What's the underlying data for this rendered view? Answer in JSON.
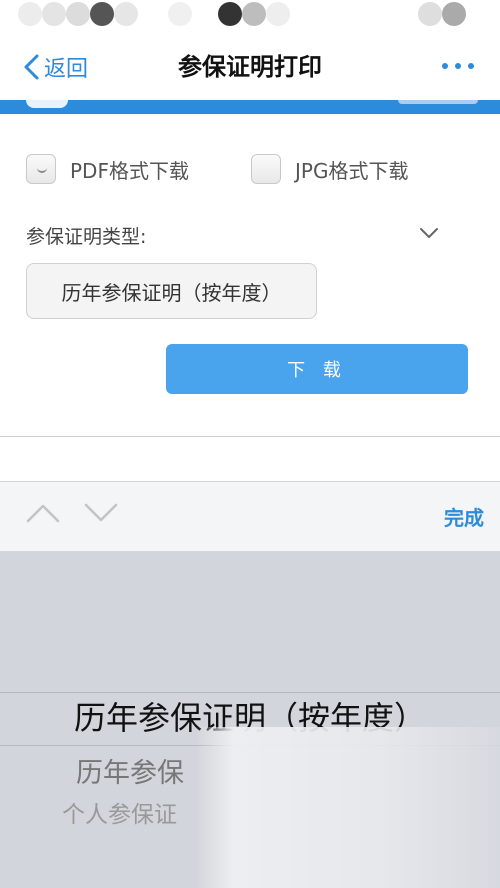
{
  "nav": {
    "back_label": "返回",
    "title": "参保证明打印"
  },
  "options": [
    {
      "label": "PDF格式下载",
      "checked": true
    },
    {
      "label": "JPG格式下载",
      "checked": false
    }
  ],
  "form": {
    "type_label": "参保证明类型:",
    "selected_value": "历年参保证明（按年度）",
    "download_label": "下 载"
  },
  "toolbar": {
    "done_label": "完成"
  },
  "picker": {
    "items": [
      "历年参保证明（按年度）",
      "历年参保",
      "个人参保证"
    ]
  },
  "colors": {
    "accent": "#2d8bdb",
    "button": "#4aa3ed",
    "picker_bg": "#d2d5db"
  }
}
